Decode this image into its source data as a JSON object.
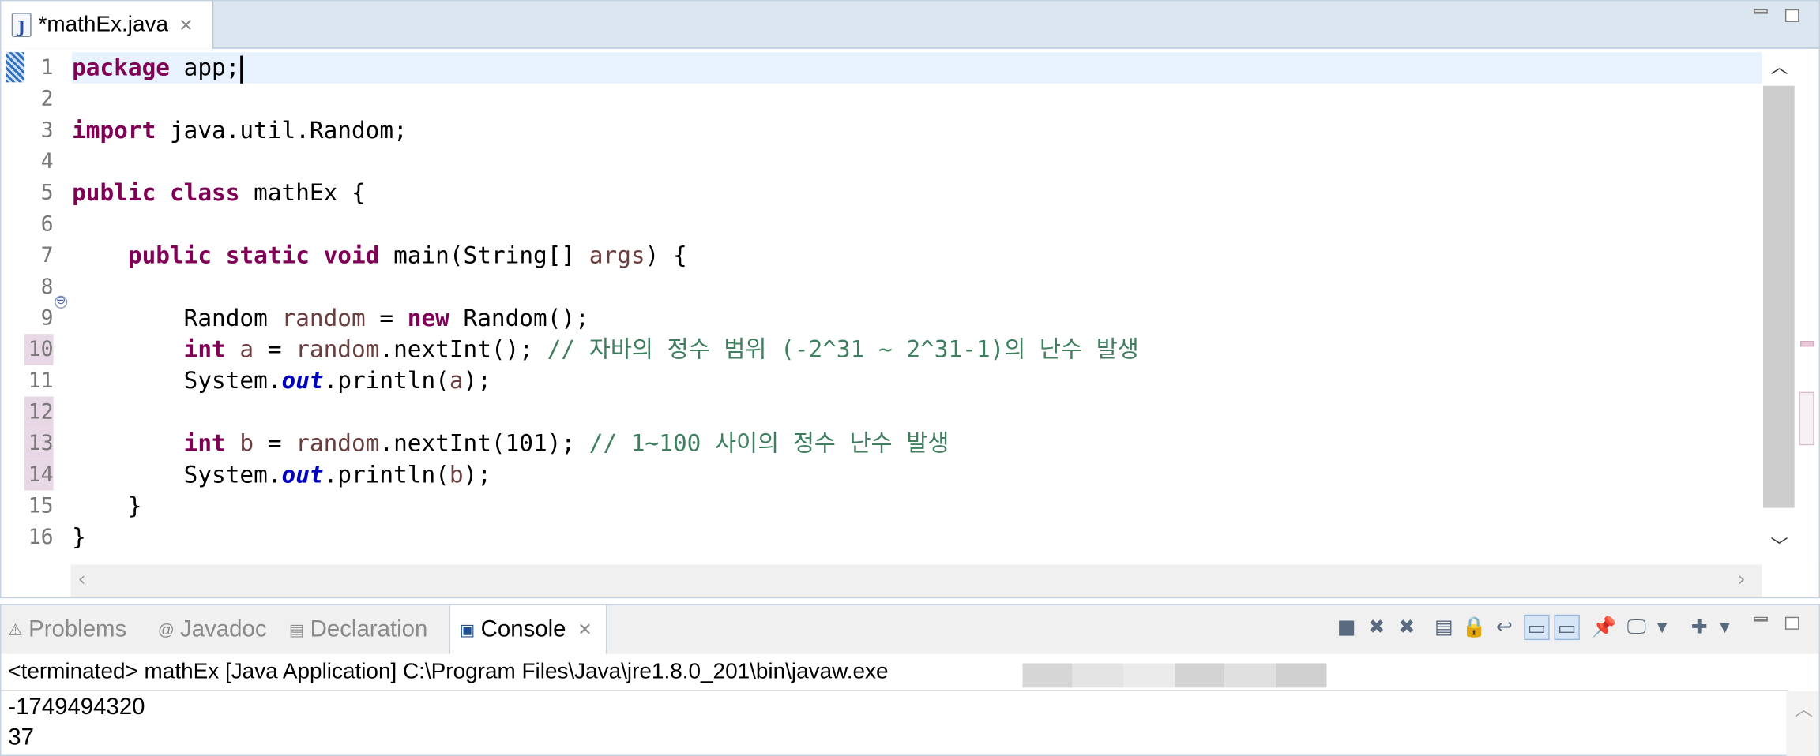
{
  "editor": {
    "tab_title": "*mathEx.java",
    "tab_close": "✕",
    "line_numbers": [
      "1",
      "2",
      "3",
      "4",
      "5",
      "6",
      "7",
      "8",
      "9",
      "10",
      "11",
      "12",
      "13",
      "14",
      "15",
      "16"
    ],
    "lines": [
      [
        {
          "t": "package",
          "c": "k"
        },
        {
          "t": " app;",
          "c": ""
        }
      ],
      [],
      [
        {
          "t": "import",
          "c": "k"
        },
        {
          "t": " java.util.Random;",
          "c": ""
        }
      ],
      [],
      [
        {
          "t": "public",
          "c": "k"
        },
        {
          "t": " ",
          "c": ""
        },
        {
          "t": "class",
          "c": "k"
        },
        {
          "t": " mathEx {",
          "c": ""
        }
      ],
      [],
      [
        {
          "t": "    ",
          "c": ""
        },
        {
          "t": "public",
          "c": "k"
        },
        {
          "t": " ",
          "c": ""
        },
        {
          "t": "static",
          "c": "k"
        },
        {
          "t": " ",
          "c": ""
        },
        {
          "t": "void",
          "c": "k"
        },
        {
          "t": " main(String[] ",
          "c": ""
        },
        {
          "t": "args",
          "c": "v"
        },
        {
          "t": ") {",
          "c": ""
        }
      ],
      [],
      [
        {
          "t": "        Random ",
          "c": ""
        },
        {
          "t": "random",
          "c": "v"
        },
        {
          "t": " = ",
          "c": ""
        },
        {
          "t": "new",
          "c": "k"
        },
        {
          "t": " Random();",
          "c": ""
        }
      ],
      [
        {
          "t": "        ",
          "c": ""
        },
        {
          "t": "int",
          "c": "k"
        },
        {
          "t": " ",
          "c": ""
        },
        {
          "t": "a",
          "c": "v"
        },
        {
          "t": " = ",
          "c": ""
        },
        {
          "t": "random",
          "c": "v"
        },
        {
          "t": ".nextInt(); ",
          "c": ""
        },
        {
          "t": "// 자바의 정수 범위 (-2^31 ~ 2^31-1)의 난수 발생",
          "c": "c"
        }
      ],
      [
        {
          "t": "        System.",
          "c": ""
        },
        {
          "t": "out",
          "c": "s"
        },
        {
          "t": ".println(",
          "c": ""
        },
        {
          "t": "a",
          "c": "v"
        },
        {
          "t": ");",
          "c": ""
        }
      ],
      [],
      [
        {
          "t": "        ",
          "c": ""
        },
        {
          "t": "int",
          "c": "k"
        },
        {
          "t": " ",
          "c": ""
        },
        {
          "t": "b",
          "c": "v"
        },
        {
          "t": " = ",
          "c": ""
        },
        {
          "t": "random",
          "c": "v"
        },
        {
          "t": ".nextInt(101); ",
          "c": ""
        },
        {
          "t": "// 1~100 사이의 정수 난수 발생",
          "c": "c"
        }
      ],
      [
        {
          "t": "        System.",
          "c": ""
        },
        {
          "t": "out",
          "c": "s"
        },
        {
          "t": ".println(",
          "c": ""
        },
        {
          "t": "b",
          "c": "v"
        },
        {
          "t": ");",
          "c": ""
        }
      ],
      [
        {
          "t": "    }",
          "c": ""
        }
      ],
      [
        {
          "t": "}",
          "c": ""
        }
      ]
    ],
    "current_line": 1,
    "changed_lines": [
      10,
      12,
      13,
      14
    ],
    "fold_marker": "⊖"
  },
  "console_view": {
    "tabs": [
      {
        "label": "Problems",
        "icon": "problems-icon",
        "glyph": "⚠"
      },
      {
        "label": "Javadoc",
        "icon": "at-icon",
        "glyph": "@"
      },
      {
        "label": "Declaration",
        "icon": "declaration-icon",
        "glyph": "▤"
      },
      {
        "label": "Console",
        "icon": "console-icon",
        "glyph": "▣",
        "active": true
      }
    ],
    "tab_close": "✕",
    "status": "<terminated> mathEx [Java Application] C:\\Program Files\\Java\\jre1.8.0_201\\bin\\javaw.exe",
    "output": [
      "-1749494320",
      "37"
    ],
    "toolbar_icons": [
      {
        "name": "terminate-icon",
        "glyph": "■"
      },
      {
        "name": "remove-launch-icon",
        "glyph": "✖"
      },
      {
        "name": "remove-all-terminated-icon",
        "glyph": "✖"
      },
      {
        "name": "clear-console-icon",
        "glyph": "▤"
      },
      {
        "name": "scroll-lock-icon",
        "glyph": "🔒"
      },
      {
        "name": "word-wrap-icon",
        "glyph": "↩"
      },
      {
        "name": "show-console-on-stdout-icon",
        "glyph": "▭",
        "sel": true
      },
      {
        "name": "show-console-on-stderr-icon",
        "glyph": "▭",
        "sel": true
      },
      {
        "name": "pin-console-icon",
        "glyph": "📌"
      },
      {
        "name": "display-console-icon",
        "glyph": "🖵"
      },
      {
        "name": "display-dropdown-icon",
        "glyph": "▾"
      },
      {
        "name": "open-console-icon",
        "glyph": "✚"
      },
      {
        "name": "open-dropdown-icon",
        "glyph": "▾"
      }
    ]
  }
}
